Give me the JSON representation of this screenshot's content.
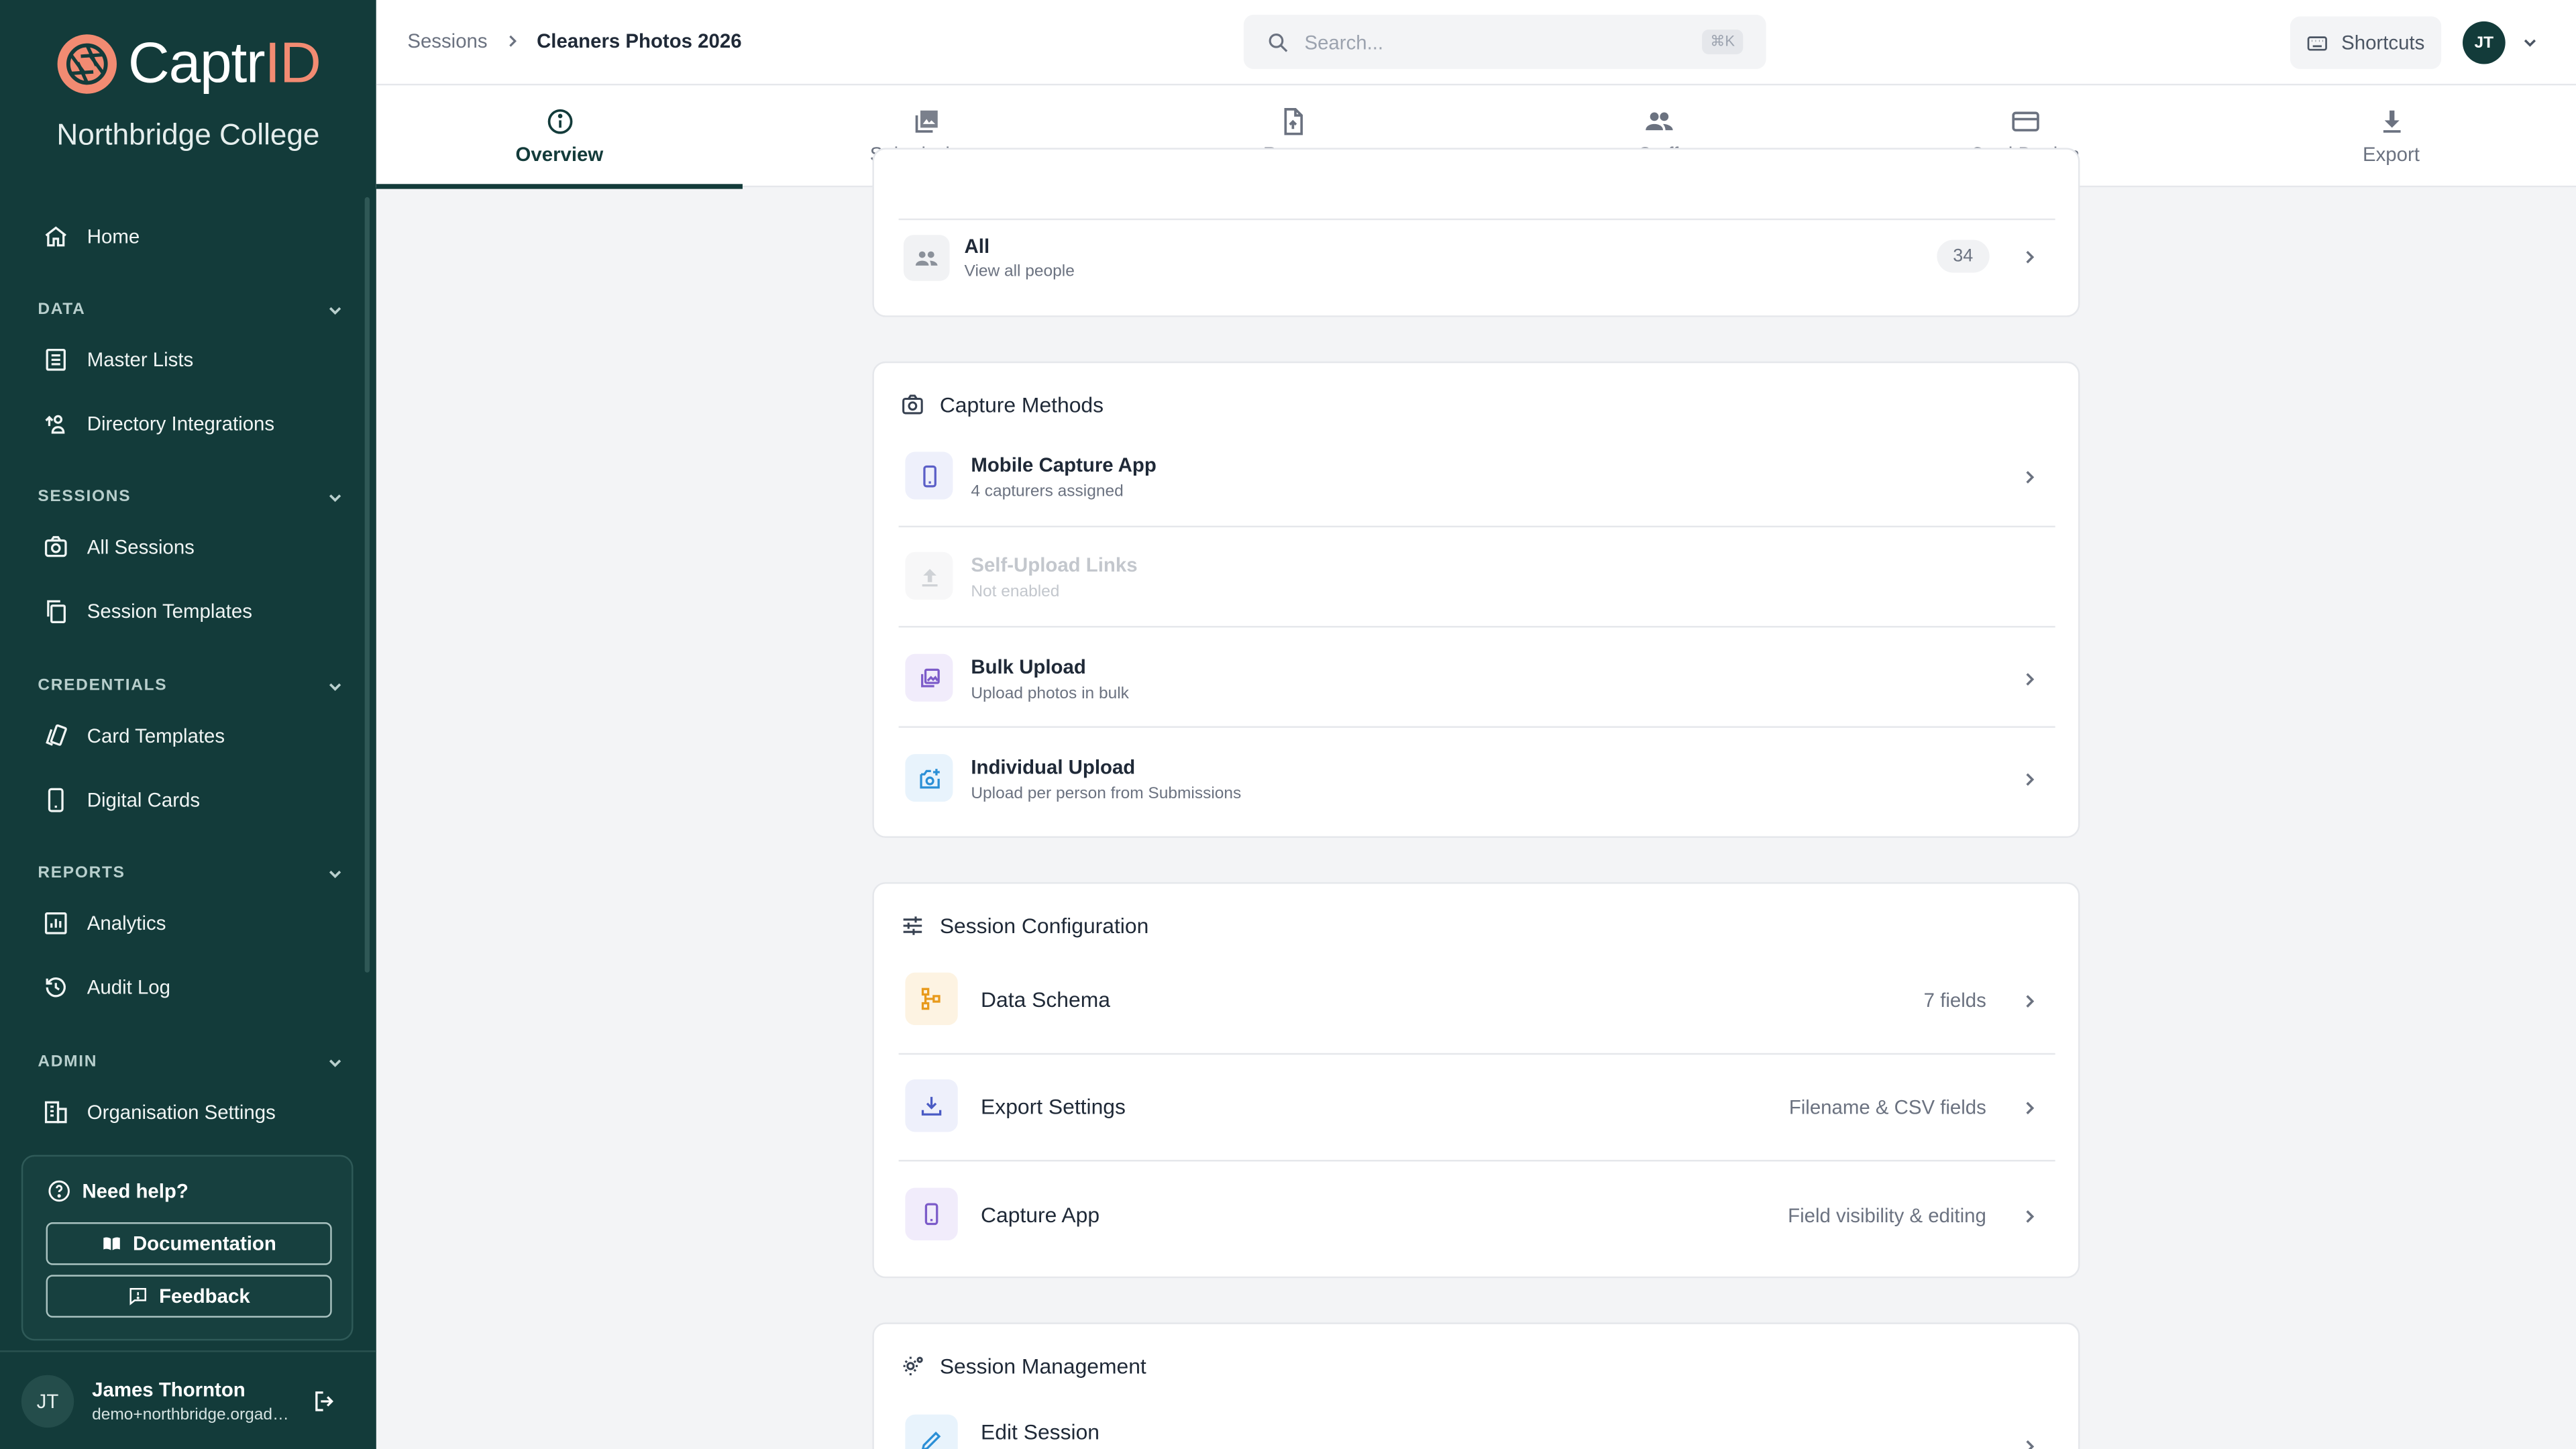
{
  "brand": {
    "name_main": "Captr",
    "name_accent": "ID",
    "org": "Northbridge College"
  },
  "colors": {
    "sidebar": "#133b3a",
    "accent": "#f28b72",
    "active_tab": "#133b3a"
  },
  "nav": {
    "home": "Home",
    "sections": {
      "data": "DATA",
      "sessions": "SESSIONS",
      "credentials": "CREDENTIALS",
      "reports": "REPORTS",
      "admin": "ADMIN"
    },
    "items": {
      "master_lists": "Master Lists",
      "directory_integrations": "Directory Integrations",
      "all_sessions": "All Sessions",
      "session_templates": "Session Templates",
      "card_templates": "Card Templates",
      "digital_cards": "Digital Cards",
      "analytics": "Analytics",
      "audit_log": "Audit Log",
      "organisation_settings": "Organisation Settings"
    }
  },
  "help": {
    "title": "Need help?",
    "documentation": "Documentation",
    "feedback": "Feedback"
  },
  "user": {
    "initials": "JT",
    "name": "James Thornton",
    "email": "demo+northbridge.orgadmin@captrid.com"
  },
  "breadcrumb": {
    "parent": "Sessions",
    "current": "Cleaners Photos 2026"
  },
  "search": {
    "placeholder": "Search...",
    "shortcut": "⌘K"
  },
  "topbar": {
    "shortcuts": "Shortcuts",
    "avatar": "JT"
  },
  "tabs": [
    "Overview",
    "Submissions",
    "Roster",
    "Staff",
    "Card Design",
    "Export"
  ],
  "people": {
    "all_title": "All",
    "all_sub": "View all people",
    "all_count": "34"
  },
  "capture_methods": {
    "title": "Capture Methods",
    "items": [
      {
        "title": "Mobile Capture App",
        "sub": "4 capturers assigned",
        "icon": "smartphone-icon"
      },
      {
        "title": "Self-Upload Links",
        "sub": "Not enabled",
        "icon": "upload-icon"
      },
      {
        "title": "Bulk Upload",
        "sub": "Upload photos in bulk",
        "icon": "photo-library-icon"
      },
      {
        "title": "Individual Upload",
        "sub": "Upload per person from Submissions",
        "icon": "add-photo-icon"
      }
    ]
  },
  "session_config": {
    "title": "Session Configuration",
    "items": [
      {
        "title": "Data Schema",
        "meta": "7 fields",
        "icon": "schema-icon"
      },
      {
        "title": "Export Settings",
        "meta": "Filename & CSV fields",
        "icon": "download-icon"
      },
      {
        "title": "Capture App",
        "meta": "Field visibility & editing",
        "icon": "smartphone-icon"
      }
    ]
  },
  "session_mgmt": {
    "title": "Session Management",
    "edit": "Edit Session"
  }
}
